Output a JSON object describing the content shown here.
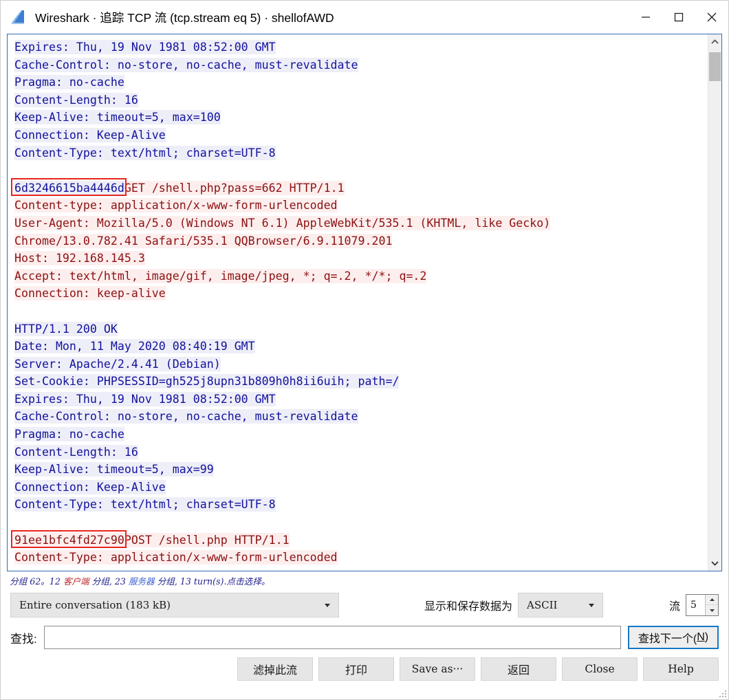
{
  "window": {
    "title": "Wireshark · 追踪 TCP 流 (tcp.stream eq 5) · shellofAWD",
    "icon": "wireshark-fin-icon",
    "minimize_label": "—",
    "maximize_label": "□",
    "close_label": "✕"
  },
  "stream": {
    "lines": [
      {
        "side": "server",
        "text": "Expires: Thu, 19 Nov 1981 08:52:00 GMT"
      },
      {
        "side": "server",
        "text": "Cache-Control: no-store, no-cache, must-revalidate"
      },
      {
        "side": "server",
        "text": "Pragma: no-cache"
      },
      {
        "side": "server",
        "text": "Content-Length: 16"
      },
      {
        "side": "server",
        "text": "Keep-Alive: timeout=5, max=100"
      },
      {
        "side": "server",
        "text": "Connection: Keep-Alive"
      },
      {
        "side": "server",
        "text": "Content-Type: text/html; charset=UTF-8"
      },
      {
        "side": "blank",
        "text": ""
      },
      {
        "side": "mixed",
        "server_text": "6d3246615ba4446d",
        "text": "GET /shell.php?pass=662 HTTP/1.1",
        "annotated": true
      },
      {
        "side": "client",
        "text": "Content-type: application/x-www-form-urlencoded"
      },
      {
        "side": "client",
        "text": "User-Agent: Mozilla/5.0 (Windows NT 6.1) AppleWebKit/535.1 (KHTML, like Gecko)"
      },
      {
        "side": "client",
        "text": "Chrome/13.0.782.41 Safari/535.1 QQBrowser/6.9.11079.201"
      },
      {
        "side": "client",
        "text": "Host: 192.168.145.3"
      },
      {
        "side": "client",
        "text": "Accept: text/html, image/gif, image/jpeg, *; q=.2, */*; q=.2"
      },
      {
        "side": "client",
        "text": "Connection: keep-alive"
      },
      {
        "side": "blank",
        "text": ""
      },
      {
        "side": "server",
        "text": "HTTP/1.1 200 OK"
      },
      {
        "side": "server",
        "text": "Date: Mon, 11 May 2020 08:40:19 GMT"
      },
      {
        "side": "server",
        "text": "Server: Apache/2.4.41 (Debian)"
      },
      {
        "side": "server",
        "text": "Set-Cookie: PHPSESSID=gh525j8upn31b809h0h8ii6uih; path=/"
      },
      {
        "side": "server",
        "text": "Expires: Thu, 19 Nov 1981 08:52:00 GMT"
      },
      {
        "side": "server",
        "text": "Cache-Control: no-store, no-cache, must-revalidate"
      },
      {
        "side": "server",
        "text": "Pragma: no-cache"
      },
      {
        "side": "server",
        "text": "Content-Length: 16"
      },
      {
        "side": "server",
        "text": "Keep-Alive: timeout=5, max=99"
      },
      {
        "side": "server",
        "text": "Connection: Keep-Alive"
      },
      {
        "side": "server",
        "text": "Content-Type: text/html; charset=UTF-8"
      },
      {
        "side": "blank",
        "text": ""
      },
      {
        "side": "client",
        "prefix_text": "91ee1bfc4fd27c90",
        "text": "POST /shell.php HTTP/1.1",
        "annotated": true
      },
      {
        "side": "client",
        "text": "Content-Type: application/x-www-form-urlencoded"
      }
    ],
    "annotation_color": "#e8241f",
    "server_color": "#12129c",
    "client_color": "#8c1111"
  },
  "status": {
    "prefix": "分组 62。12 ",
    "client_word": "客户端",
    "mid1": " 分组, 23 ",
    "server_word": "服务器",
    "mid2": " 分组, 13 turn(s).",
    "suffix": "点击选择。"
  },
  "controls": {
    "conversation_value": "Entire conversation (183 kB)",
    "show_save_label": "显示和保存数据为",
    "format_value": "ASCII",
    "stream_label": "流",
    "stream_value": "5"
  },
  "find": {
    "label": "查找:",
    "value": "",
    "placeholder": "",
    "next_button_text": "查找下一个(",
    "next_button_mnemonic": "N",
    "next_button_tail": ")"
  },
  "buttons": [
    {
      "label": "滤掉此流",
      "cjk": true
    },
    {
      "label": "打印",
      "cjk": true
    },
    {
      "label": "Save as···",
      "cjk": false
    },
    {
      "label": "返回",
      "cjk": true
    },
    {
      "label": "Close",
      "cjk": false
    },
    {
      "label": "Help",
      "cjk": false
    }
  ]
}
